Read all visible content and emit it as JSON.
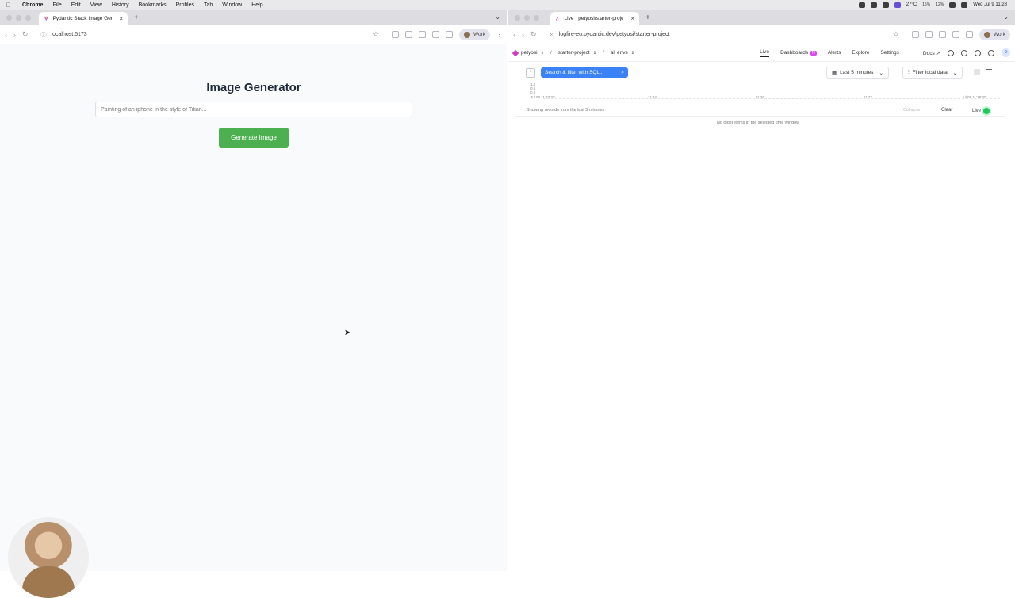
{
  "menubar": {
    "items": [
      "Chrome",
      "File",
      "Edit",
      "View",
      "History",
      "Bookmarks",
      "Profiles",
      "Tab",
      "Window",
      "Help"
    ],
    "status": {
      "temp": "27°C",
      "datetime": "Wed Jul 9 11:28",
      "cpu": "15%",
      "mem": "12%"
    }
  },
  "left_window": {
    "tab_title": "Pydantic Stack Image Generator",
    "url": "localhost:5173",
    "profile": "Work",
    "page": {
      "title": "Image Generator",
      "prompt_placeholder": "Painting of an iphone in the style of Titian...",
      "generate_label": "Generate Image"
    }
  },
  "right_window": {
    "tab_title": "Live · petyosi/starter-project",
    "url": "logfire-eu.pydantic.dev/petyosi/starter-project",
    "profile": "Work",
    "breadcrumb": {
      "org": "petyosi",
      "project": "starter-project",
      "env": "all envs"
    },
    "nav": {
      "live": "Live",
      "dashboards": "Dashboards",
      "dashboards_badge": "N",
      "alerts": "Alerts",
      "explore": "Explore",
      "settings": "Settings",
      "docs": "Docs"
    },
    "avatar_initial": "P",
    "search_placeholder": "Search & filter with SQL...",
    "slash": "/",
    "time_range": "Last 5 minutes",
    "local_filter": "Filter local data",
    "histogram": {
      "y_ticks": [
        "1.0",
        "0.5",
        "0.0"
      ],
      "x_ticks": [
        "Jul 09 11:23:30",
        "11:24",
        "11:26",
        "11:27",
        "Jul 09 11:28:30"
      ]
    },
    "showing": "Showing records from the last 5 minutes",
    "collapse": "Collapse",
    "clear": "Clear",
    "live": "Live",
    "empty": "No older items in the selected time window"
  },
  "colors": {
    "accent_green": "#4caf50",
    "accent_blue": "#3b82f6",
    "brand_pink": "#d33bbd"
  }
}
